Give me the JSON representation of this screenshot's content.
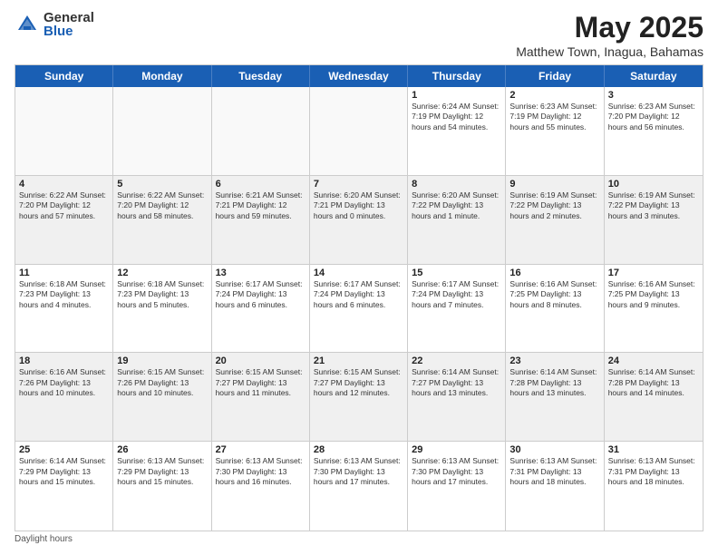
{
  "logo": {
    "general": "General",
    "blue": "Blue"
  },
  "title": "May 2025",
  "location": "Matthew Town, Inagua, Bahamas",
  "days": [
    "Sunday",
    "Monday",
    "Tuesday",
    "Wednesday",
    "Thursday",
    "Friday",
    "Saturday"
  ],
  "weeks": [
    [
      {
        "date": "",
        "info": "",
        "empty": true
      },
      {
        "date": "",
        "info": "",
        "empty": true
      },
      {
        "date": "",
        "info": "",
        "empty": true
      },
      {
        "date": "",
        "info": "",
        "empty": true
      },
      {
        "date": "1",
        "info": "Sunrise: 6:24 AM\nSunset: 7:19 PM\nDaylight: 12 hours\nand 54 minutes.",
        "empty": false
      },
      {
        "date": "2",
        "info": "Sunrise: 6:23 AM\nSunset: 7:19 PM\nDaylight: 12 hours\nand 55 minutes.",
        "empty": false
      },
      {
        "date": "3",
        "info": "Sunrise: 6:23 AM\nSunset: 7:20 PM\nDaylight: 12 hours\nand 56 minutes.",
        "empty": false
      }
    ],
    [
      {
        "date": "4",
        "info": "Sunrise: 6:22 AM\nSunset: 7:20 PM\nDaylight: 12 hours\nand 57 minutes.",
        "empty": false
      },
      {
        "date": "5",
        "info": "Sunrise: 6:22 AM\nSunset: 7:20 PM\nDaylight: 12 hours\nand 58 minutes.",
        "empty": false
      },
      {
        "date": "6",
        "info": "Sunrise: 6:21 AM\nSunset: 7:21 PM\nDaylight: 12 hours\nand 59 minutes.",
        "empty": false
      },
      {
        "date": "7",
        "info": "Sunrise: 6:20 AM\nSunset: 7:21 PM\nDaylight: 13 hours\nand 0 minutes.",
        "empty": false
      },
      {
        "date": "8",
        "info": "Sunrise: 6:20 AM\nSunset: 7:22 PM\nDaylight: 13 hours\nand 1 minute.",
        "empty": false
      },
      {
        "date": "9",
        "info": "Sunrise: 6:19 AM\nSunset: 7:22 PM\nDaylight: 13 hours\nand 2 minutes.",
        "empty": false
      },
      {
        "date": "10",
        "info": "Sunrise: 6:19 AM\nSunset: 7:22 PM\nDaylight: 13 hours\nand 3 minutes.",
        "empty": false
      }
    ],
    [
      {
        "date": "11",
        "info": "Sunrise: 6:18 AM\nSunset: 7:23 PM\nDaylight: 13 hours\nand 4 minutes.",
        "empty": false
      },
      {
        "date": "12",
        "info": "Sunrise: 6:18 AM\nSunset: 7:23 PM\nDaylight: 13 hours\nand 5 minutes.",
        "empty": false
      },
      {
        "date": "13",
        "info": "Sunrise: 6:17 AM\nSunset: 7:24 PM\nDaylight: 13 hours\nand 6 minutes.",
        "empty": false
      },
      {
        "date": "14",
        "info": "Sunrise: 6:17 AM\nSunset: 7:24 PM\nDaylight: 13 hours\nand 6 minutes.",
        "empty": false
      },
      {
        "date": "15",
        "info": "Sunrise: 6:17 AM\nSunset: 7:24 PM\nDaylight: 13 hours\nand 7 minutes.",
        "empty": false
      },
      {
        "date": "16",
        "info": "Sunrise: 6:16 AM\nSunset: 7:25 PM\nDaylight: 13 hours\nand 8 minutes.",
        "empty": false
      },
      {
        "date": "17",
        "info": "Sunrise: 6:16 AM\nSunset: 7:25 PM\nDaylight: 13 hours\nand 9 minutes.",
        "empty": false
      }
    ],
    [
      {
        "date": "18",
        "info": "Sunrise: 6:16 AM\nSunset: 7:26 PM\nDaylight: 13 hours\nand 10 minutes.",
        "empty": false
      },
      {
        "date": "19",
        "info": "Sunrise: 6:15 AM\nSunset: 7:26 PM\nDaylight: 13 hours\nand 10 minutes.",
        "empty": false
      },
      {
        "date": "20",
        "info": "Sunrise: 6:15 AM\nSunset: 7:27 PM\nDaylight: 13 hours\nand 11 minutes.",
        "empty": false
      },
      {
        "date": "21",
        "info": "Sunrise: 6:15 AM\nSunset: 7:27 PM\nDaylight: 13 hours\nand 12 minutes.",
        "empty": false
      },
      {
        "date": "22",
        "info": "Sunrise: 6:14 AM\nSunset: 7:27 PM\nDaylight: 13 hours\nand 13 minutes.",
        "empty": false
      },
      {
        "date": "23",
        "info": "Sunrise: 6:14 AM\nSunset: 7:28 PM\nDaylight: 13 hours\nand 13 minutes.",
        "empty": false
      },
      {
        "date": "24",
        "info": "Sunrise: 6:14 AM\nSunset: 7:28 PM\nDaylight: 13 hours\nand 14 minutes.",
        "empty": false
      }
    ],
    [
      {
        "date": "25",
        "info": "Sunrise: 6:14 AM\nSunset: 7:29 PM\nDaylight: 13 hours\nand 15 minutes.",
        "empty": false
      },
      {
        "date": "26",
        "info": "Sunrise: 6:13 AM\nSunset: 7:29 PM\nDaylight: 13 hours\nand 15 minutes.",
        "empty": false
      },
      {
        "date": "27",
        "info": "Sunrise: 6:13 AM\nSunset: 7:30 PM\nDaylight: 13 hours\nand 16 minutes.",
        "empty": false
      },
      {
        "date": "28",
        "info": "Sunrise: 6:13 AM\nSunset: 7:30 PM\nDaylight: 13 hours\nand 17 minutes.",
        "empty": false
      },
      {
        "date": "29",
        "info": "Sunrise: 6:13 AM\nSunset: 7:30 PM\nDaylight: 13 hours\nand 17 minutes.",
        "empty": false
      },
      {
        "date": "30",
        "info": "Sunrise: 6:13 AM\nSunset: 7:31 PM\nDaylight: 13 hours\nand 18 minutes.",
        "empty": false
      },
      {
        "date": "31",
        "info": "Sunrise: 6:13 AM\nSunset: 7:31 PM\nDaylight: 13 hours\nand 18 minutes.",
        "empty": false
      }
    ]
  ],
  "footer": "Daylight hours"
}
